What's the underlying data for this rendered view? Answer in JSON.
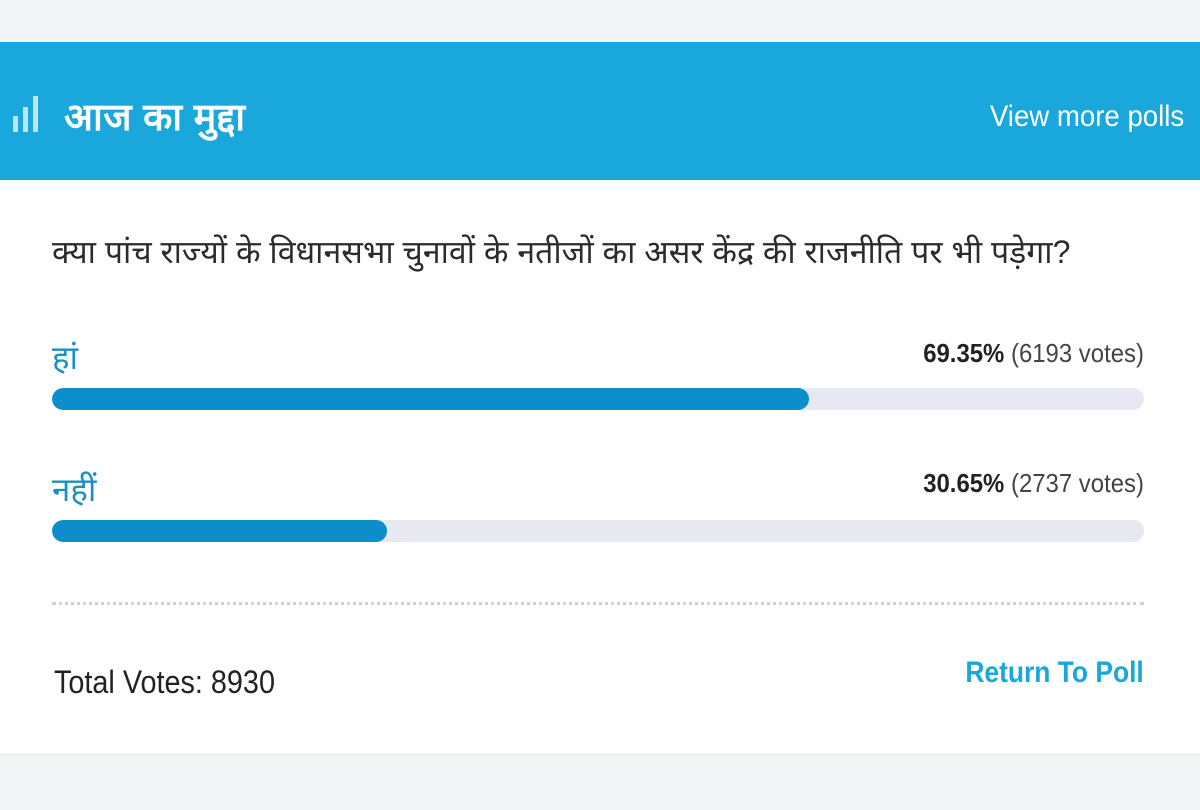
{
  "header": {
    "icon": "bar-chart-icon",
    "title": "आज का मुद्दा",
    "view_more": "View more polls",
    "background": "#1aa7db"
  },
  "poll": {
    "question": "क्या पांच राज्यों के विधानसभा चुनावों के नतीजों का असर केंद्र की राजनीति पर भी पड़ेगा?",
    "options": [
      {
        "label": "हां",
        "percent_text": "69.35%",
        "votes_text": "(6193 votes)",
        "fraction": 0.6935
      },
      {
        "label": "नहीं",
        "percent_text": "30.65%",
        "votes_text": "(2737 votes)",
        "fraction": 0.3065
      }
    ],
    "total_votes": "Total Votes: 8930",
    "return_label": "Return To Poll"
  },
  "colors": {
    "accent": "#1aa7db",
    "bar_fill": "#0b8ec9",
    "bar_track": "#e7e8f2",
    "option_text": "#1a8fc4"
  }
}
